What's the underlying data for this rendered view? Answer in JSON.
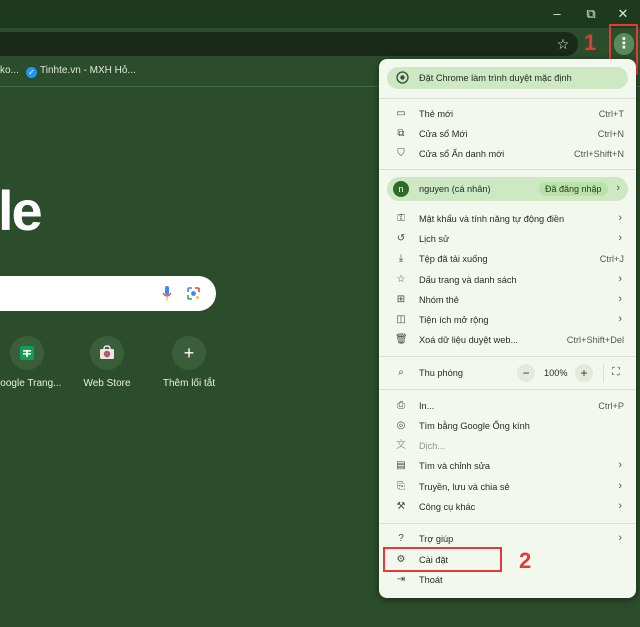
{
  "window": {
    "minimize": "–",
    "restore": "⧉",
    "close": "✕"
  },
  "toolbar": {
    "bookmark_icon": "star-icon",
    "menu_icon": "kebab-menu-icon"
  },
  "bookmarks": [
    {
      "label": "ko..."
    },
    {
      "label": "Tinhte.vn - MXH Hỏ..."
    }
  ],
  "ntp": {
    "logo_text": "le",
    "shortcuts": [
      {
        "label": "Google Trang...",
        "icon": "google-sheets-icon"
      },
      {
        "label": "Web Store",
        "icon": "web-store-icon"
      },
      {
        "label": "Thêm lối tắt",
        "icon": "plus-icon"
      }
    ]
  },
  "annotations": {
    "step1": "1",
    "step2": "2"
  },
  "menu": {
    "set_default": "Đặt Chrome làm trình duyệt mặc định",
    "new_tab": {
      "label": "Thẻ mới",
      "shortcut": "Ctrl+T"
    },
    "new_window": {
      "label": "Cửa sổ Mới",
      "shortcut": "Ctrl+N"
    },
    "incognito": {
      "label": "Cửa sổ Ẩn danh mới",
      "shortcut": "Ctrl+Shift+N"
    },
    "profile": {
      "initial": "n",
      "name": "nguyen (cá nhân)",
      "status": "Đã đăng nhập"
    },
    "passwords": {
      "label": "Mật khẩu và tính năng tự động điền"
    },
    "history": {
      "label": "Lịch sử"
    },
    "downloads": {
      "label": "Tệp đã tải xuống",
      "shortcut": "Ctrl+J"
    },
    "bookmarks": {
      "label": "Dấu trang và danh sách"
    },
    "tab_groups": {
      "label": "Nhóm thẻ"
    },
    "extensions": {
      "label": "Tiện ích mở rộng"
    },
    "clear_data": {
      "label": "Xoá dữ liệu duyệt web...",
      "shortcut": "Ctrl+Shift+Del"
    },
    "zoom": {
      "label": "Thu phóng",
      "minus": "−",
      "value": "100%",
      "plus": "+"
    },
    "print": {
      "label": "In...",
      "shortcut": "Ctrl+P"
    },
    "lens": {
      "label": "Tìm bằng Google Ống kính"
    },
    "translate": {
      "label": "Dịch..."
    },
    "find_edit": {
      "label": "Tìm và chỉnh sửa"
    },
    "cast_save_share": {
      "label": "Truyền, lưu và chia sẻ"
    },
    "more_tools": {
      "label": "Công cụ khác"
    },
    "help": {
      "label": "Trợ giúp"
    },
    "settings": {
      "label": "Cài đặt"
    },
    "exit": {
      "label": "Thoát"
    }
  },
  "colors": {
    "theme_bg": "#2c4d2b",
    "menu_bg": "#f3f8ef",
    "highlight": "#cde8c3",
    "annotation": "#e53935"
  }
}
